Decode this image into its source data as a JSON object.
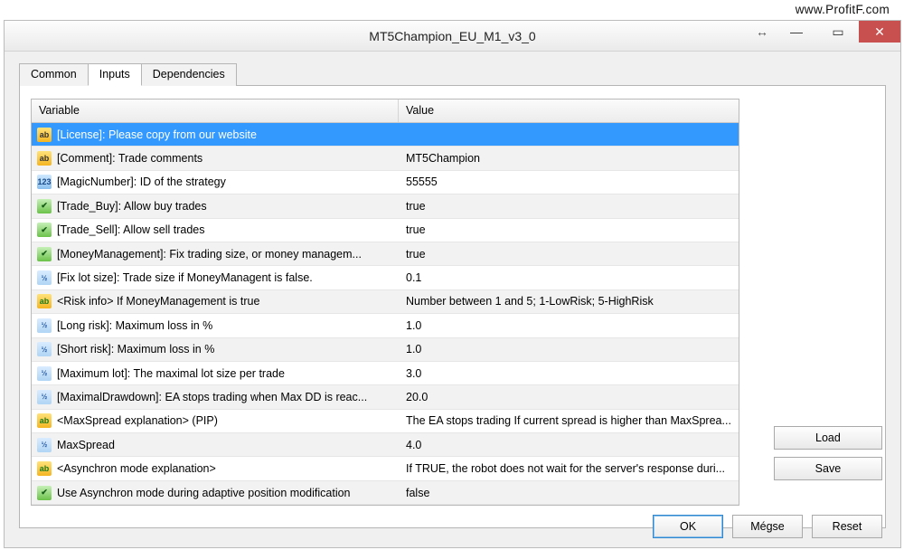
{
  "watermark": "www.ProfitF.com",
  "window_title": "MT5Champion_EU_M1_v3_0",
  "tabs": {
    "common": "Common",
    "inputs": "Inputs",
    "deps": "Dependencies"
  },
  "columns": {
    "variable": "Variable",
    "value": "Value"
  },
  "rows": [
    {
      "icon": "ab",
      "var": "[License]: Please copy from our website",
      "val": ""
    },
    {
      "icon": "ab",
      "var": "[Comment]: Trade comments",
      "val": "MT5Champion"
    },
    {
      "icon": "num",
      "var": "[MagicNumber]: ID of the strategy",
      "val": "55555"
    },
    {
      "icon": "bool",
      "var": "[Trade_Buy]: Allow buy trades",
      "val": "true"
    },
    {
      "icon": "bool",
      "var": "[Trade_Sell]: Allow sell trades",
      "val": "true"
    },
    {
      "icon": "bool",
      "var": "[MoneyManagement]: Fix trading size, or money managem...",
      "val": "true"
    },
    {
      "icon": "dec",
      "var": "[Fix lot size]: Trade size if MoneyManagent is false.",
      "val": "0.1"
    },
    {
      "icon": "abg",
      "var": "<Risk info> If MoneyManagement is true",
      "val": "Number between 1 and 5; 1-LowRisk; 5-HighRisk"
    },
    {
      "icon": "dec",
      "var": "[Long risk]: Maximum loss in %",
      "val": "1.0"
    },
    {
      "icon": "dec",
      "var": "[Short risk]: Maximum loss in %",
      "val": "1.0"
    },
    {
      "icon": "dec",
      "var": "[Maximum lot]: The maximal lot size per trade",
      "val": "3.0"
    },
    {
      "icon": "dec",
      "var": "[MaximalDrawdown]: EA stops trading when Max DD is reac...",
      "val": "20.0"
    },
    {
      "icon": "abg",
      "var": "<MaxSpread explanation> (PIP)",
      "val": "The EA stops trading If current spread is higher than MaxSprea..."
    },
    {
      "icon": "dec",
      "var": "MaxSpread",
      "val": "4.0"
    },
    {
      "icon": "abg",
      "var": "<Asynchron mode explanation>",
      "val": "If TRUE, the robot does not wait for the server's response duri..."
    },
    {
      "icon": "bool",
      "var": "Use Asynchron mode during adaptive position modification",
      "val": "false"
    }
  ],
  "buttons": {
    "load": "Load",
    "save": "Save",
    "ok": "OK",
    "cancel": "Mégse",
    "reset": "Reset"
  }
}
